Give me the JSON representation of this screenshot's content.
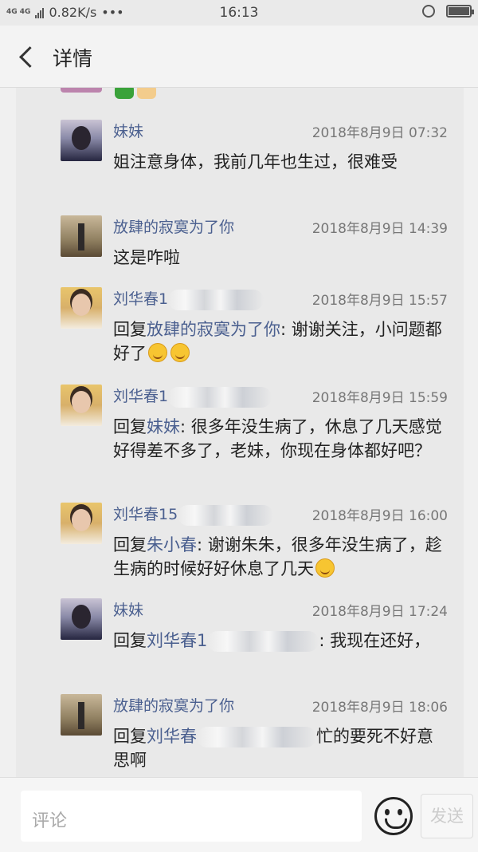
{
  "status_bar": {
    "network": "4G 4G",
    "speed": "0.82K/s",
    "dots": "•••",
    "time": "16:13"
  },
  "header": {
    "title": "详情"
  },
  "comments": [
    {
      "name": "妹妹",
      "time": "2018年8月9日 07:32",
      "body": "姐注意身体，我前几年也生过，很难受"
    },
    {
      "name": "放肆的寂寞为了你",
      "time": "2018年8月9日 14:39",
      "body": "这是咋啦"
    },
    {
      "name": "刘华春1",
      "time": "2018年8月9日 15:57",
      "reply_prefix": "回复",
      "reply_to": "放肆的寂寞为了你",
      "body": ": 谢谢关注，小问题都好了"
    },
    {
      "name": "刘华春1",
      "time": "2018年8月9日 15:59",
      "reply_prefix": "回复",
      "reply_to": "妹妹",
      "body": ": 很多年没生病了，休息了几天感觉好得差不多了，老妹，你现在身体都好吧？"
    },
    {
      "name": "刘华春15",
      "time": "2018年8月9日 16:00",
      "reply_prefix": "回复",
      "reply_to": "朱小春",
      "body": ": 谢谢朱朱，很多年没生病了，趁生病的时候好好休息了几天"
    },
    {
      "name": "妹妹",
      "time": "2018年8月9日 17:24",
      "reply_prefix": "回复",
      "reply_to": "刘华春1",
      "body": ": 我现在还好，"
    },
    {
      "name": "放肆的寂寞为了你",
      "time": "2018年8月9日 18:06",
      "reply_prefix": "回复",
      "reply_to": "刘华春",
      "body": "忙的要死不好意思啊"
    }
  ],
  "composer": {
    "placeholder": "评论",
    "send_label": "发送"
  }
}
